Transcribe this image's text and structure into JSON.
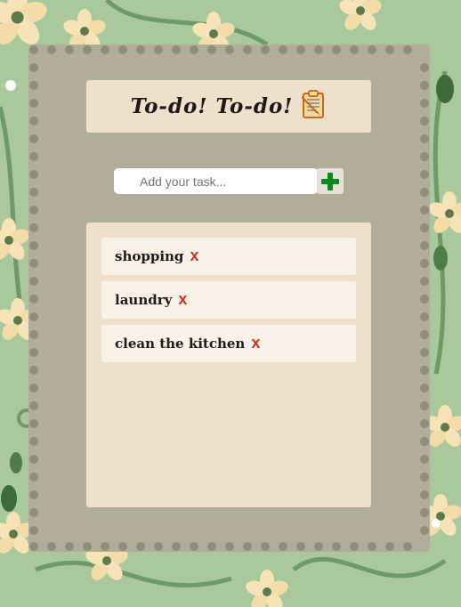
{
  "app": {
    "title": "To-do! To-do!"
  },
  "input": {
    "placeholder": "Add your task...",
    "value": ""
  },
  "add_button": {
    "icon": "plus-icon"
  },
  "tasks": [
    {
      "label": "shopping",
      "delete_label": "x"
    },
    {
      "label": "laundry",
      "delete_label": "x"
    },
    {
      "label": "clean the kitchen",
      "delete_label": "x"
    }
  ],
  "colors": {
    "background": "#a7c69a",
    "card": "#b0ad98",
    "panel": "#efe0cb",
    "task_item": "#faf1e8",
    "delete": "#cc3320",
    "add_plus": "#0a8a1a"
  }
}
